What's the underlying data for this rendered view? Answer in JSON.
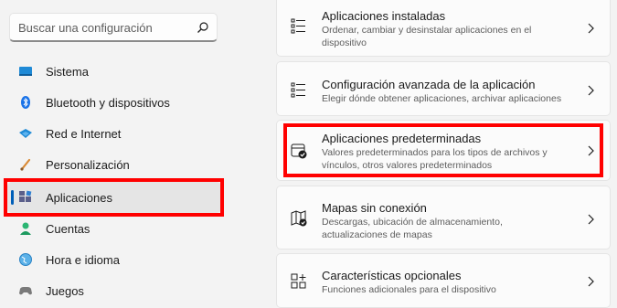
{
  "search": {
    "placeholder": "Buscar una configuración",
    "icon": "search-icon"
  },
  "sidebar": {
    "items": [
      {
        "label": "Sistema",
        "icon": "system-icon"
      },
      {
        "label": "Bluetooth y dispositivos",
        "icon": "bluetooth-icon"
      },
      {
        "label": "Red e Internet",
        "icon": "network-icon"
      },
      {
        "label": "Personalización",
        "icon": "brush-icon"
      },
      {
        "label": "Aplicaciones",
        "icon": "apps-icon",
        "selected": true
      },
      {
        "label": "Cuentas",
        "icon": "accounts-icon"
      },
      {
        "label": "Hora e idioma",
        "icon": "globe-icon"
      },
      {
        "label": "Juegos",
        "icon": "gamepad-icon"
      }
    ]
  },
  "cards": [
    {
      "title": "Aplicaciones instaladas",
      "desc": "Ordenar, cambiar y desinstalar aplicaciones en el dispositivo",
      "icon": "installed-apps-icon"
    },
    {
      "title": "Configuración avanzada de la aplicación",
      "desc": "Elegir dónde obtener aplicaciones, archivar aplicaciones",
      "icon": "advanced-apps-icon"
    },
    {
      "title": "Aplicaciones predeterminadas",
      "desc": "Valores predeterminados para los tipos de archivos y vínculos, otros valores predeterminados",
      "icon": "default-apps-icon"
    },
    {
      "title": "Mapas sin conexión",
      "desc": "Descargas, ubicación de almacenamiento, actualizaciones de mapas",
      "icon": "offline-maps-icon"
    },
    {
      "title": "Características opcionales",
      "desc": "Funciones adicionales para el dispositivo",
      "icon": "optional-features-icon"
    }
  ],
  "colors": {
    "accent": "#005fb8",
    "highlight": "#ff0000",
    "background": "#f3f3f3",
    "card": "#fbfbfb"
  }
}
